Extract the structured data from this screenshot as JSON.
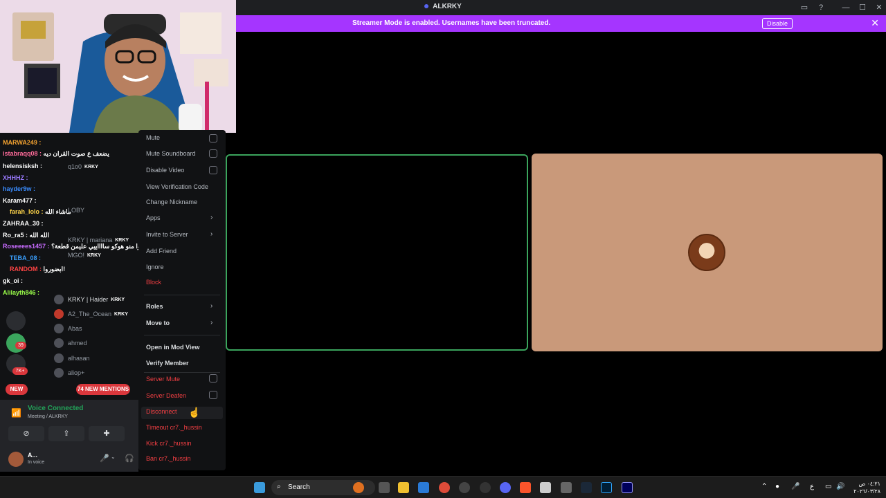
{
  "app": {
    "title": "ALKRKY"
  },
  "banner": {
    "message": "Streamer Mode is enabled. Usernames have been truncated.",
    "button": "Disable"
  },
  "chat": [
    {
      "user": "MARWA249 :",
      "color": "#f0a030",
      "text": ""
    },
    {
      "user": "istabraqq08 :",
      "color": "#ff6b9a",
      "text": "يضعف ع صوت القران ديه"
    },
    {
      "user": "helensisksh :",
      "color": "#ffffff",
      "text": ""
    },
    {
      "user": "XHHHZ :",
      "color": "#9b7bff",
      "text": ""
    },
    {
      "user": "hayder9w :",
      "color": "#3a8cff",
      "text": ""
    },
    {
      "user": "Karam477 :",
      "color": "#ffffff",
      "text": ""
    },
    {
      "user": "farah_lolo :",
      "color": "#ffd54a",
      "text": "ماشاء الله"
    },
    {
      "user": "ZAHRAA_30 :",
      "color": "#ffffff",
      "text": ""
    },
    {
      "user": "Ro_ra5 :",
      "color": "#ffffff",
      "text": "الله الله"
    },
    {
      "user": "Roseeees1457 :",
      "color": "#c86bff",
      "text": "جيبين جايبوا منو هوكو سااااييي عليمن قطعة؟"
    },
    {
      "user": "TEBA_08 :",
      "color": "#3aa0ff",
      "text": ""
    },
    {
      "user": "RANDOM :",
      "color": "#ff4444",
      "text": "ابضوروا!"
    },
    {
      "user": "gk_oi :",
      "color": "#ffffff",
      "text": ""
    },
    {
      "user": "Alilayth846 :",
      "color": "#9bff4a",
      "text": ""
    }
  ],
  "members": [
    {
      "name": "q1o0",
      "badge": "KRKY"
    },
    {
      "name": "LOBY",
      "badge": ""
    },
    {
      "name": "KRKY | mariana",
      "badge": "KRKY"
    },
    {
      "name": "MGO!",
      "badge": "KRKY"
    },
    {
      "name": "KRKY | Haider",
      "badge": "KRKY"
    },
    {
      "name": "A2_The_Ocean",
      "badge": "KRKY"
    },
    {
      "name": "Abas",
      "badge": ""
    },
    {
      "name": "ahmed",
      "badge": ""
    },
    {
      "name": "alhasan",
      "badge": ""
    },
    {
      "name": "aliop+",
      "badge": ""
    }
  ],
  "guild_badges": {
    "g1": "39",
    "g2": "7K+",
    "new": "NEW"
  },
  "mentions": "74 NEW MENTIONS",
  "voice": {
    "status": "Voice Connected",
    "channel": "Meeting / ALKRKY"
  },
  "user": {
    "name": "A...",
    "status": "In voice"
  },
  "menu": {
    "mute": "Mute",
    "mute_soundboard": "Mute Soundboard",
    "disable_video": "Disable Video",
    "view_verification": "View Verification Code",
    "change_nickname": "Change Nickname",
    "apps": "Apps",
    "invite": "Invite to Server",
    "add_friend": "Add Friend",
    "ignore": "Ignore",
    "block": "Block",
    "roles": "Roles",
    "move_to": "Move to",
    "mod_view": "Open in Mod View",
    "verify": "Verify Member",
    "server_mute": "Server Mute",
    "server_deafen": "Server Deafen",
    "disconnect": "Disconnect",
    "timeout": "Timeout cr7._hussin",
    "kick": "Kick cr7._hussin",
    "ban": "Ban cr7._hussin"
  },
  "taskbar": {
    "search": "Search",
    "time": "٠٤:٢١ ص",
    "date": "٢٠٢٦/٠٣/٢٨",
    "lang": "ع"
  },
  "colors": {
    "accent": "#a535ff",
    "danger": "#f23f43",
    "online": "#23a55a"
  }
}
